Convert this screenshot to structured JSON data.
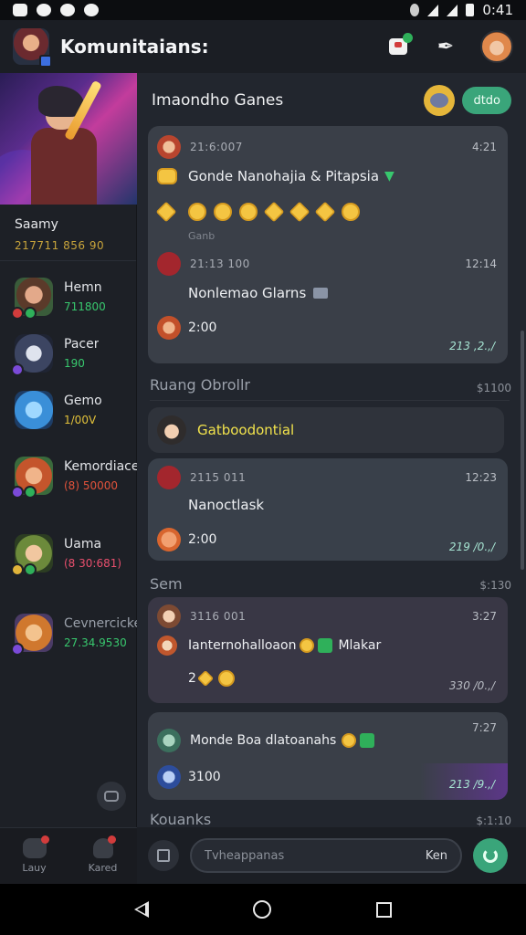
{
  "status_bar": {
    "time": "0:41"
  },
  "header": {
    "title": "Komunitaians:"
  },
  "sidebar": {
    "profile_name": "Saamy",
    "profile_sub": "217711 856 90",
    "friends": [
      {
        "name": "Hemn",
        "value": "711800",
        "color": "#38c86e"
      },
      {
        "name": "Pacer",
        "value": "190",
        "color": "#38c86e"
      },
      {
        "name": "Gemo",
        "value": "1/00V",
        "color": "#e2c13a"
      },
      {
        "name": "Kemordiace",
        "value": "(8) 50000",
        "color": "#e2533b"
      },
      {
        "name": "Uama",
        "value": "(8 30:681)",
        "color": "#e84f6d"
      },
      {
        "name": "Cevnercicke",
        "value": "27.34.9530",
        "color": "#38c86e"
      }
    ],
    "tabs": [
      {
        "label": "Lauy"
      },
      {
        "label": "Kared"
      }
    ]
  },
  "main": {
    "section_title": "Imaondho Ganes",
    "pill_button": "dtdo",
    "card1": {
      "meta_left": "21:6:007",
      "meta_right": "4:21",
      "title": "Gonde Nanohajia & Pitapsia",
      "caption": "Ganb",
      "meta2_left": "21:13 100",
      "meta2_right": "12:14",
      "message": "Nonlemao Glarns",
      "count": "2:00",
      "stamp": "213 ,2.,/"
    },
    "section2": {
      "title": "Ruang Obrollr",
      "right": "$1100"
    },
    "highlight": "Gatboodontial",
    "card2": {
      "meta_left": "2115 011",
      "meta_right": "12:23",
      "message": "Nanoctlask",
      "count": "2:00",
      "stamp": "219 /0.,/"
    },
    "section3": {
      "title": "Sem",
      "right": "$:130"
    },
    "card3": {
      "meta_left": "3116 001",
      "meta_right": "3:27",
      "message": "Ianternohalloaon",
      "message_tail": "Mlakar",
      "count": "2",
      "stamp": "330 /0.,/"
    },
    "card4": {
      "meta_right": "7:27",
      "message": "Monde Boa dlatoanahs",
      "count": "3100",
      "stamp": "213 /9.,/"
    },
    "section4": {
      "title": "Kouanks",
      "right": "$:1:10"
    }
  },
  "compose": {
    "placeholder": "Tvheappanas",
    "right_text": "Ken"
  },
  "colors": {
    "accent": "#3aa57a",
    "highlight_text": "#f2e34c",
    "gold": "#c8a43b"
  },
  "icons": [
    "gift-icon",
    "send-icon",
    "notification-icon",
    "quill-icon",
    "chat-icon"
  ]
}
